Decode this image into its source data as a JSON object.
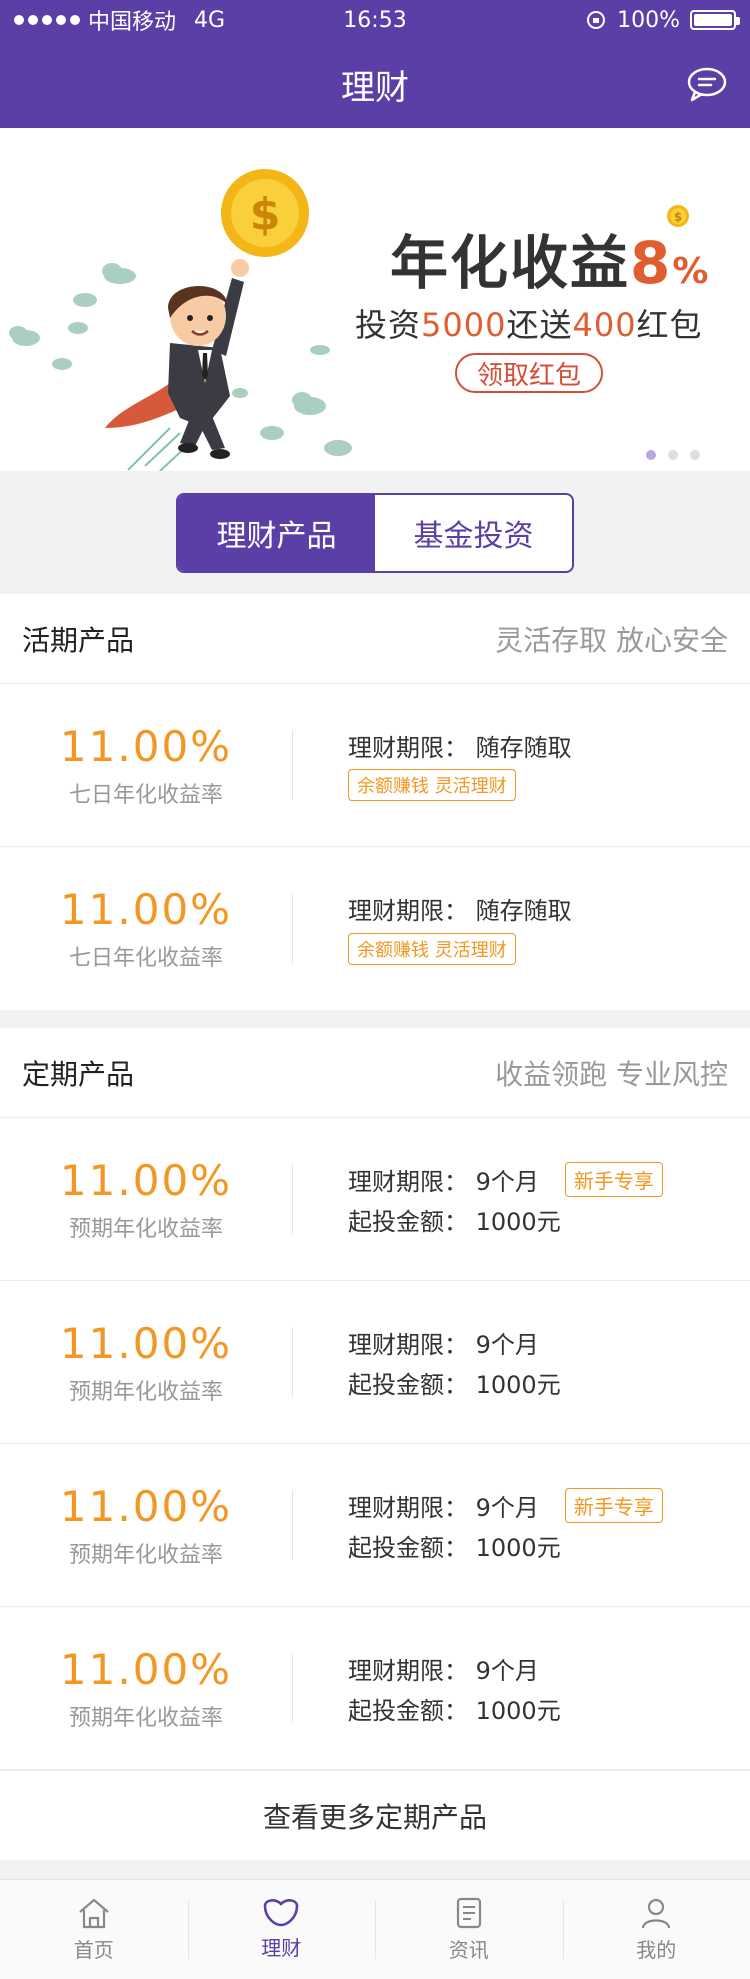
{
  "status_bar": {
    "carrier": "中国移动",
    "network": "4G",
    "time": "16:53",
    "battery": "100%"
  },
  "nav": {
    "title": "理财",
    "message_icon": "chat-bubble-icon"
  },
  "banner": {
    "headline": "年化收益",
    "headline_rate": "8",
    "headline_pct": "%",
    "sub_prefix": "投资",
    "sub_amount": "5000",
    "sub_middle": "还送",
    "sub_bonus": "400",
    "sub_suffix": "红包",
    "cta": "领取红包",
    "page_count": 3,
    "active_page": 1
  },
  "switcher": {
    "tabs": [
      "理财产品",
      "基金投资"
    ],
    "active": 0
  },
  "current_section": {
    "title": "活期产品",
    "slogan": "灵活存取 放心安全",
    "items": [
      {
        "rate": "11.00%",
        "rate_label": "七日年化收益率",
        "term": "理财期限：  随存随取",
        "tag": "余额赚钱 灵活理财"
      },
      {
        "rate": "11.00%",
        "rate_label": "七日年化收益率",
        "term": "理财期限：  随存随取",
        "tag": "余额赚钱 灵活理财"
      }
    ]
  },
  "fixed_section": {
    "title": "定期产品",
    "slogan": "收益领跑 专业风控",
    "items": [
      {
        "rate": "11.00%",
        "rate_label": "预期年化收益率",
        "term": "理财期限：  9个月",
        "amount": "起投金额：  1000元",
        "badge": "新手专享"
      },
      {
        "rate": "11.00%",
        "rate_label": "预期年化收益率",
        "term": "理财期限：  9个月",
        "amount": "起投金额：  1000元",
        "badge": ""
      },
      {
        "rate": "11.00%",
        "rate_label": "预期年化收益率",
        "term": "理财期限：  9个月",
        "amount": "起投金额：  1000元",
        "badge": "新手专享"
      },
      {
        "rate": "11.00%",
        "rate_label": "预期年化收益率",
        "term": "理财期限：  9个月",
        "amount": "起投金额：  1000元",
        "badge": ""
      }
    ],
    "more": "查看更多定期产品"
  },
  "tabbar": {
    "items": [
      {
        "label": "首页",
        "icon": "home-icon"
      },
      {
        "label": "理财",
        "icon": "finance-icon"
      },
      {
        "label": "资讯",
        "icon": "news-icon"
      },
      {
        "label": "我的",
        "icon": "profile-icon"
      }
    ],
    "active": 1
  },
  "colors": {
    "brand": "#5b3fa6",
    "accent": "#f39722",
    "highlight": "#e05d2f"
  }
}
